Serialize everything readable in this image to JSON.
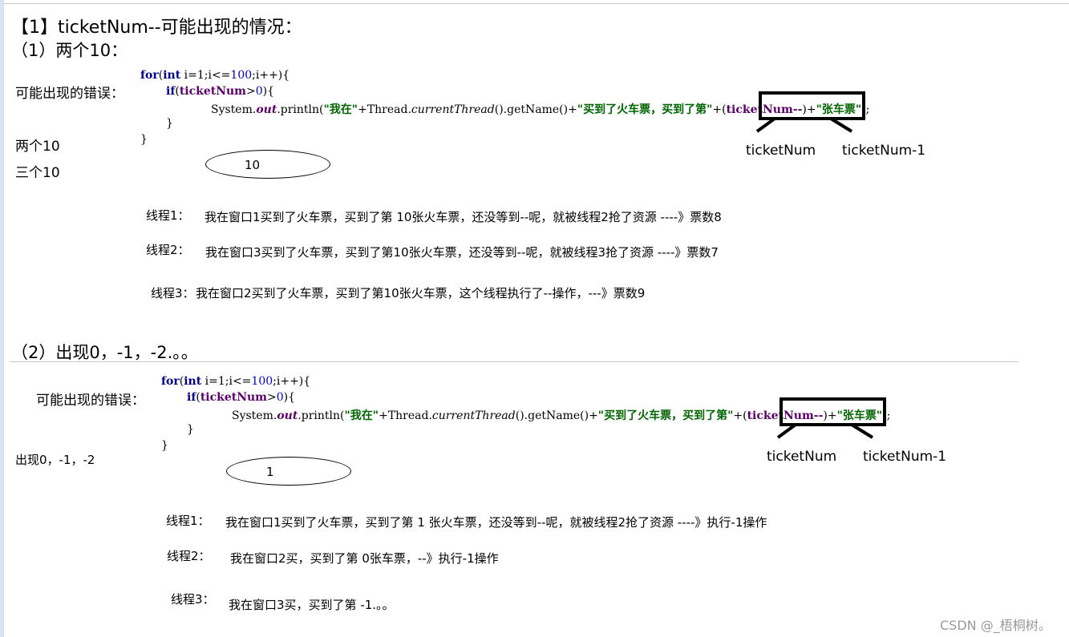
{
  "section1": {
    "heading": "【1】ticketNum--可能出现的情况：",
    "subheading": "（1）两个10：",
    "error_label": "可能出现的错误：",
    "side_notes": [
      "两个10",
      "三个10"
    ],
    "code": {
      "line1": {
        "kw": "for",
        "p1": "(",
        "kw2": "int",
        "rest": " i=1;i<=",
        "num": "100",
        "rest2": ";i++){"
      },
      "line2": {
        "kw": "if",
        "p1": "(",
        "var": "ticketNum",
        "gt": ">",
        "num": "0",
        "rest": "){"
      },
      "line3": {
        "a": "System.",
        "out": "out",
        "b": ".println(",
        "s1": "\"我在\"",
        "c": "+Thread.",
        "m": "currentThread",
        "d": "().getName()+",
        "s2": "\"买到了火车票，买到了第\"",
        "e": "+(",
        "var": "ticketNum--",
        "f": ")+",
        "s3": "\"张车票\"",
        "g": ");"
      },
      "line4": "}",
      "line5": "}"
    },
    "annot_left": "ticketNum",
    "annot_right": "ticketNum-1",
    "ellipse_value": "10",
    "threads": [
      {
        "name": "线程1：",
        "text": "我在窗口1买到了火车票，买到了第 10张火车票，还没等到--呢，就被线程2抢了资源 ----》票数8"
      },
      {
        "name": "线程2：",
        "text": "我在窗口3买到了火车票，买到了第10张火车票，还没等到--呢，就被线程3抢了资源 ----》票数7"
      },
      {
        "name": "线程3：",
        "text": "我在窗口2买到了火车票，买到了第10张火车票，这个线程执行了--操作，---》票数9"
      }
    ]
  },
  "section2": {
    "subheading": "（2）出现0，-1，-2.。。",
    "error_label": "可能出现的错误：",
    "side_note": "出现0，-1，-2",
    "code": {
      "line1": {
        "kw": "for",
        "p1": "(",
        "kw2": "int",
        "rest": " i=1;i<=",
        "num": "100",
        "rest2": ";i++){"
      },
      "line2": {
        "kw": "if",
        "p1": "(",
        "var": "ticketNum",
        "gt": ">",
        "num": "0",
        "rest": "){"
      },
      "line3": {
        "a": "System.",
        "out": "out",
        "b": ".println(",
        "s1": "\"我在\"",
        "c": "+Thread.",
        "m": "currentThread",
        "d": "().getName()+",
        "s2": "\"买到了火车票，买到了第\"",
        "e": "+(",
        "var": "ticketNum--",
        "f": ")+",
        "s3": "\"张车票\"",
        "g": ");"
      },
      "line4": "}",
      "line5": "}"
    },
    "annot_left": "ticketNum",
    "annot_right": "ticketNum-1",
    "ellipse_value": "1",
    "threads": [
      {
        "name": "线程1：",
        "text": "我在窗口1买到了火车票，买到了第 1 张火车票，还没等到--呢，就被线程2抢了资源 ----》执行-1操作"
      },
      {
        "name": "线程2：",
        "text": "我在窗口2买，买到了第 0张车票，--》执行-1操作"
      },
      {
        "name": "线程3：",
        "text": "我在窗口3买，买到了第 -1.。。"
      }
    ]
  },
  "watermark": "CSDN @_梧桐树。"
}
